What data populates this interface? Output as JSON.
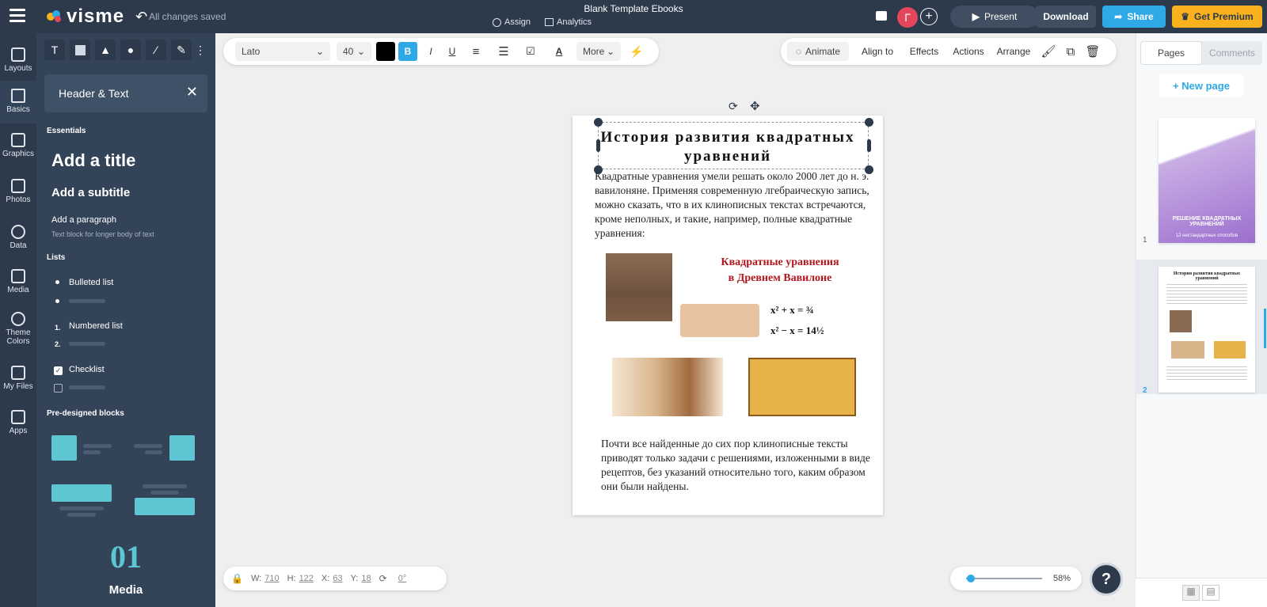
{
  "topbar": {
    "logo_text": "visme",
    "save_status": "All changes saved",
    "doc_title": "Blank Template Ebooks",
    "assign_label": "Assign",
    "analytics_label": "Analytics",
    "avatar_initial": "Г",
    "present_label": "Present",
    "download_label": "Download",
    "share_label": "Share",
    "premium_label": "Get Premium"
  },
  "rail": {
    "items": [
      {
        "label": "Layouts",
        "icon": "layouts-icon"
      },
      {
        "label": "Basics",
        "icon": "basics-icon"
      },
      {
        "label": "Graphics",
        "icon": "graphics-icon"
      },
      {
        "label": "Photos",
        "icon": "photos-icon"
      },
      {
        "label": "Data",
        "icon": "data-icon"
      },
      {
        "label": "Media",
        "icon": "media-icon"
      },
      {
        "label": "Theme",
        "label2": "Colors",
        "icon": "theme-colors-icon"
      },
      {
        "label": "My Files",
        "icon": "my-files-icon"
      },
      {
        "label": "Apps",
        "icon": "apps-icon"
      }
    ]
  },
  "panel": {
    "header": "Header & Text",
    "essentials": "Essentials",
    "add_title": "Add a title",
    "add_subtitle": "Add a subtitle",
    "add_paragraph": "Add a paragraph",
    "paragraph_hint": "Text block for longer body of text",
    "lists": "Lists",
    "bulleted": "Bulleted list",
    "numbered": "Numbered list",
    "num1": "1.",
    "num2": "2.",
    "checklist": "Checklist",
    "predesigned": "Pre-designed blocks",
    "big_number": "01",
    "media_label": "Media"
  },
  "toolbar": {
    "font": "Lato",
    "size": "40",
    "bold": "B",
    "italic": "I",
    "underline": "U",
    "more": "More",
    "animate": "Animate",
    "align_to": "Align to",
    "effects": "Effects",
    "actions": "Actions",
    "arrange": "Arrange"
  },
  "page": {
    "title": "История развития квадратных уравнений",
    "para1": "Квадратные уравнения умели решать около 2000 лет до н. э. вавилоняне. Применяя современную лгебраическую запись, можно сказать, что в их клинописных текстах встречаются, кроме неполных, и такие, например, полные квадратные уравнения:",
    "image_title_1": "Квадратные уравнения",
    "image_title_2": "в Древнем Вавилоне",
    "eq1": "x² + x = ¾",
    "eq2": "x² − x = 14½",
    "para2": "Почти все найденные до сих пор клинописные тексты приводят только задачи с решениями, изложенными в виде рецептов, без указаний относительно того, каким образом они были найдены."
  },
  "rightpanel": {
    "tab_pages": "Pages",
    "tab_comments": "Comments",
    "new_page": "+ New page",
    "page1_num": "1",
    "page2_num": "2",
    "thumb1_title": "РЕШЕНИЕ КВАДРАТНЫХ УРАВНЕНИЙ",
    "thumb1_sub": "12 нестандартных способов",
    "thumb2_title": "История развития квадратных уравнений"
  },
  "bottom": {
    "w_label": "W:",
    "w_value": "710",
    "h_label": "H:",
    "h_value": "122",
    "x_label": "X:",
    "x_value": "63",
    "y_label": "Y:",
    "y_value": "18",
    "rot_value": "0°",
    "zoom": "58%",
    "zoom_fraction": 0.06,
    "help": "?"
  },
  "colors": {
    "topbar": "#2c3a4b",
    "accent": "#2ea8e6",
    "premium": "#f9b21d",
    "avatar": "#e4475b",
    "block": "#5ec6d2"
  }
}
